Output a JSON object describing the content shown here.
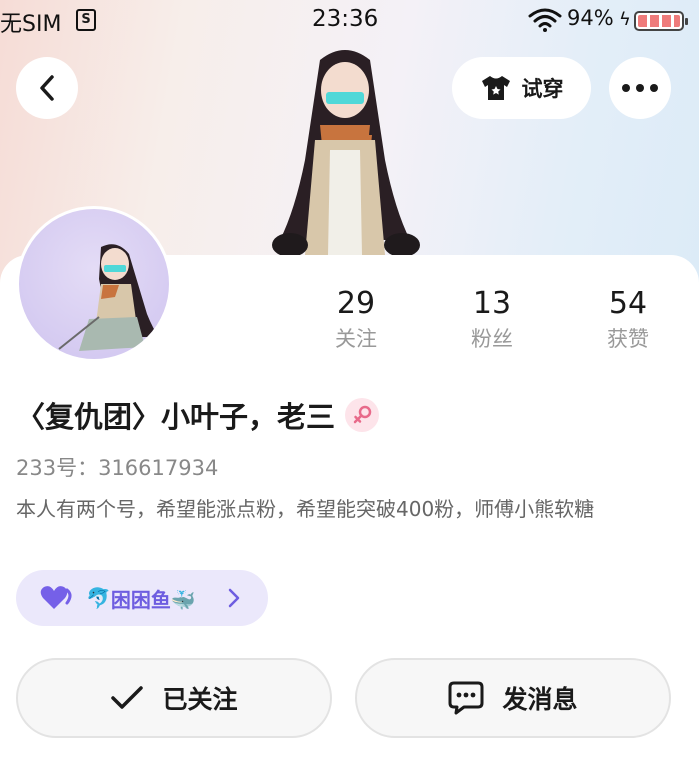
{
  "status_bar": {
    "carrier": "无SIM",
    "sim_icon": "sim-card-icon",
    "time": "23:36",
    "wifi_icon": "wifi-icon",
    "battery_percent": "94%",
    "charging_icon": "lightning-icon",
    "battery_icon": "battery-icon"
  },
  "header": {
    "back_icon": "chevron-left-icon",
    "tryon_label": "试穿",
    "tryon_icon": "tshirt-icon",
    "more_icon": "more-dots-icon"
  },
  "profile": {
    "stats": [
      {
        "value": "29",
        "label": "关注"
      },
      {
        "value": "13",
        "label": "粉丝"
      },
      {
        "value": "54",
        "label": "获赞"
      }
    ],
    "username": "〈复仇团〉小叶子，老三",
    "gender_icon": "female-icon",
    "uid": "233号：316617934",
    "bio": "本人有两个号，希望能涨点粉，希望能突破400粉，师傅小熊软糖",
    "fan_group": {
      "name": "困困鱼🐳",
      "prefix_icon": "🐬",
      "heart_icon": "heart-icon"
    }
  },
  "actions": {
    "follow_label": "已关注",
    "follow_icon": "checkmark-icon",
    "message_label": "发消息",
    "message_icon": "chat-bubble-icon"
  },
  "colors": {
    "accent_purple": "#6e5de0",
    "fan_chip_bg": "#ebe8fb",
    "female_pink": "#e86a8a"
  }
}
